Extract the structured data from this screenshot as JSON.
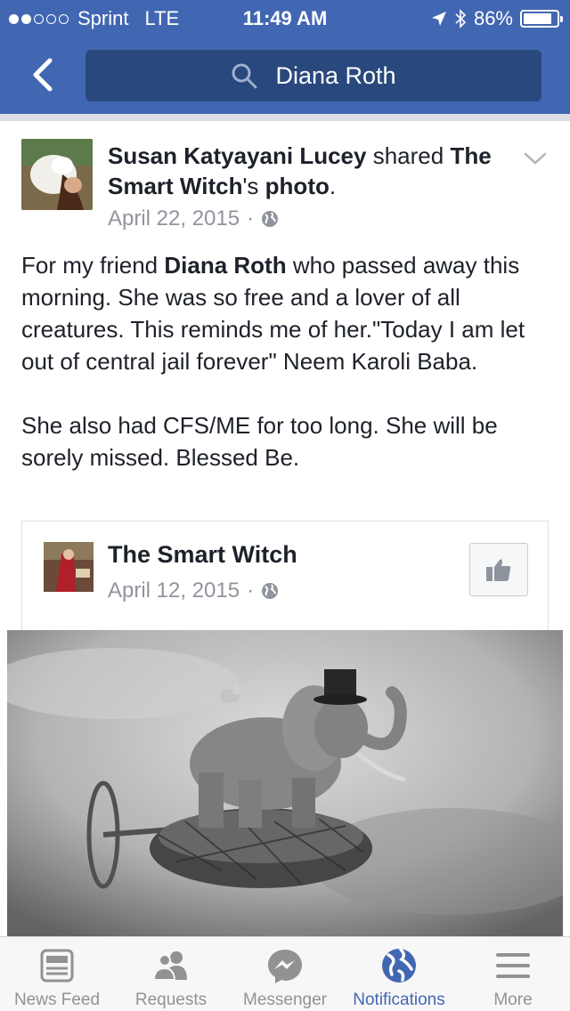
{
  "status_bar": {
    "carrier": "Sprint",
    "network": "LTE",
    "time": "11:49 AM",
    "battery": "86%",
    "battery_level": 0.86,
    "signal_bars": 2
  },
  "nav": {
    "search_text": "Diana Roth"
  },
  "post": {
    "author": "Susan Katyayani Lucey",
    "action": "shared",
    "shared_from": "The Smart Witch",
    "shared_suffix": "'s",
    "object": "photo",
    "period": ".",
    "date": "April 22, 2015",
    "separator": "·",
    "body_p1_a": "For my friend ",
    "body_p1_name": "Diana Roth",
    "body_p1_b": " who passed away this morning. She was so free and a lover of all creatures. This reminds me of her.\"Today I am let out of central jail forever\" Neem Karoli Baba.",
    "body_p2": "She also had CFS/ME for too long. She will be sorely missed. Blessed Be."
  },
  "shared_post": {
    "page_name": "The Smart Witch",
    "date": "April 12, 2015",
    "separator": "·"
  },
  "tabs": [
    {
      "label": "News Feed",
      "icon": "news-feed-icon",
      "active": false
    },
    {
      "label": "Requests",
      "icon": "friend-requests-icon",
      "active": false
    },
    {
      "label": "Messenger",
      "icon": "messenger-icon",
      "active": false
    },
    {
      "label": "Notifications",
      "icon": "globe-icon",
      "active": true
    },
    {
      "label": "More",
      "icon": "menu-icon",
      "active": false
    }
  ],
  "colors": {
    "brand": "#4267b2",
    "search_bg": "#29487d",
    "meta_text": "#90949c",
    "tab_inactive": "#929292"
  }
}
